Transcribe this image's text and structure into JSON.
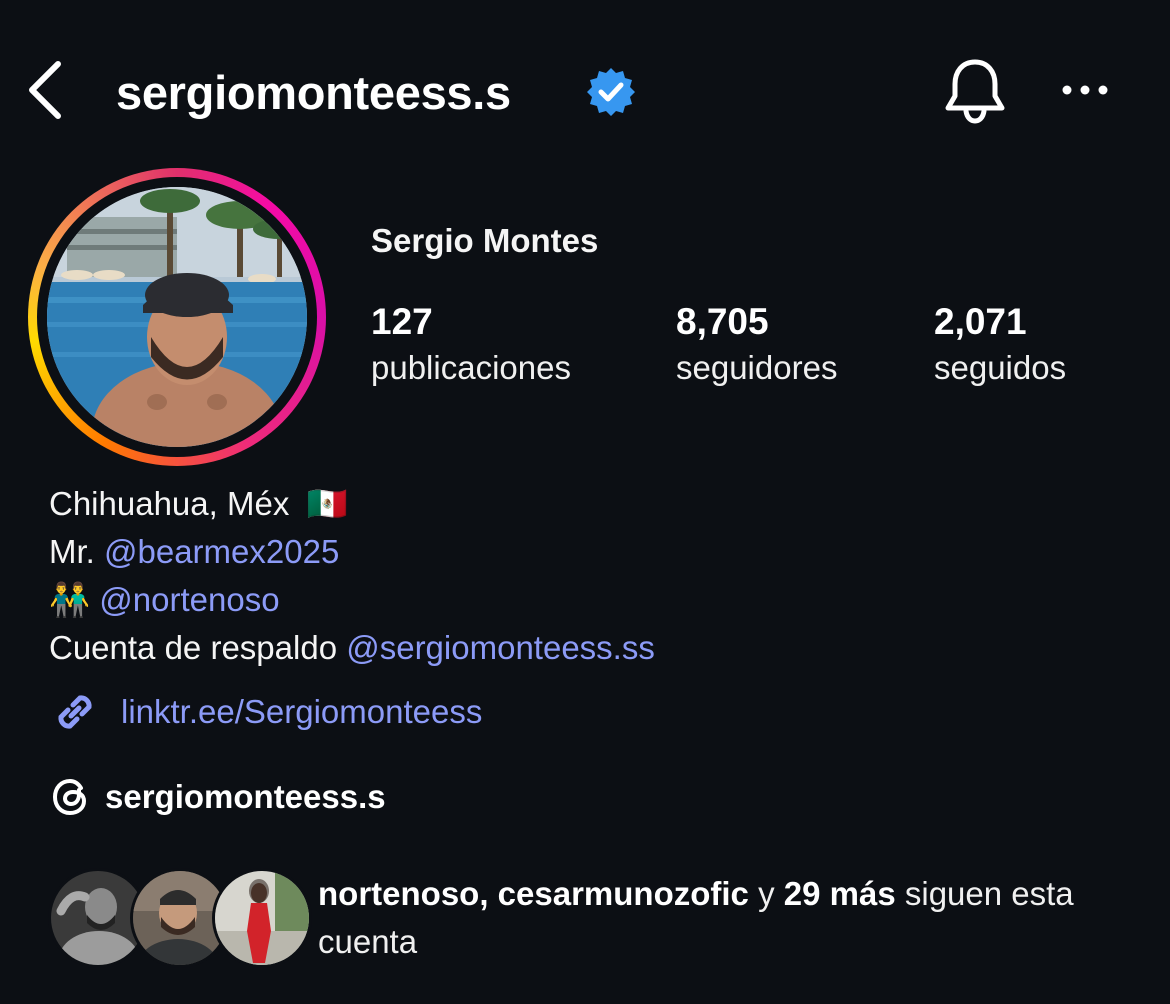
{
  "header": {
    "username": "sergiomonteess.s",
    "verified_color": "#3797f0"
  },
  "profile": {
    "display_name": "Sergio Montes",
    "stats": [
      {
        "value": "127",
        "label": "publicaciones"
      },
      {
        "value": "8,705",
        "label": "seguidores"
      },
      {
        "value": "2,071",
        "label": "seguidos"
      }
    ]
  },
  "bio": {
    "location": "Chihuahua, Méx",
    "location_emoji": "🇲🇽",
    "line2_prefix": "Mr.",
    "line2_mention": "@bearmex2025",
    "line3_emoji": "👬",
    "line3_mention": "@nortenoso",
    "line4_prefix": "Cuenta de respaldo",
    "line4_mention": "@sergiomonteess.ss",
    "link": "linktr.ee/Sergiomonteess",
    "threads_handle": "sergiomonteess.s"
  },
  "followed_by": {
    "name1": "nortenoso",
    "name2": "cesarmunozofic",
    "connector": "y",
    "more": "29 más",
    "suffix": "siguen esta cuenta"
  },
  "colors": {
    "background": "#0c0f14",
    "link": "#8c9bf7"
  }
}
